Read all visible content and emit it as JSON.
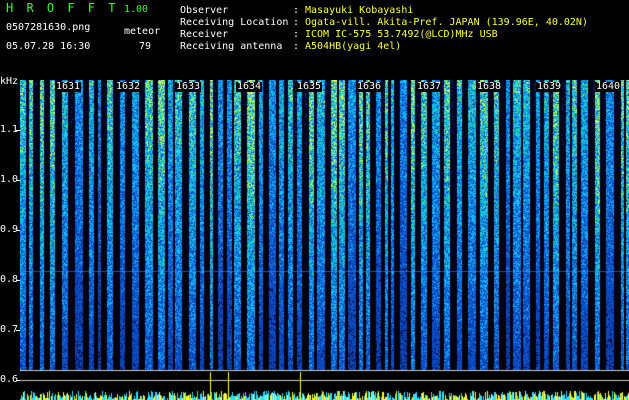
{
  "header": {
    "app_name": "H R O F F T",
    "version": "1.00",
    "filename": "0507281630.png",
    "datetime": "05.07.28 16:30",
    "meteor_label": "meteor",
    "meteor_count": "79",
    "fields": [
      {
        "label": "Observer",
        "sep": ":",
        "value": "Masayuki Kobayashi"
      },
      {
        "label": "Receiving Location",
        "sep": ":",
        "value": "Ogata-vill. Akita-Pref. JAPAN (139.96E, 40.02N)"
      },
      {
        "label": "Receiver",
        "sep": ":",
        "value": "ICOM IC-575 53.7492(@LCD)MHz USB"
      },
      {
        "label": "Receiving antenna",
        "sep": ":",
        "value": "A504HB(yagi 4el)"
      }
    ]
  },
  "axis": {
    "unit": "kHz",
    "ticks": [
      "1.1",
      "1.0",
      "0.9",
      "0.8",
      "0.7",
      "0.6"
    ]
  },
  "minute_markers": [
    "1631",
    "1632",
    "1633",
    "1634",
    "1635",
    "1636",
    "1637",
    "1638",
    "1639",
    "1640"
  ],
  "colors": {
    "background": "#000000",
    "header_green": "#2cff2c",
    "header_yellow": "#ffff33",
    "spectrum_low": "#0a1a6a",
    "spectrum_mid": "#1f5fff",
    "spectrum_high": "#22e0c0",
    "baseline_cyan": "#33e0ff"
  }
}
